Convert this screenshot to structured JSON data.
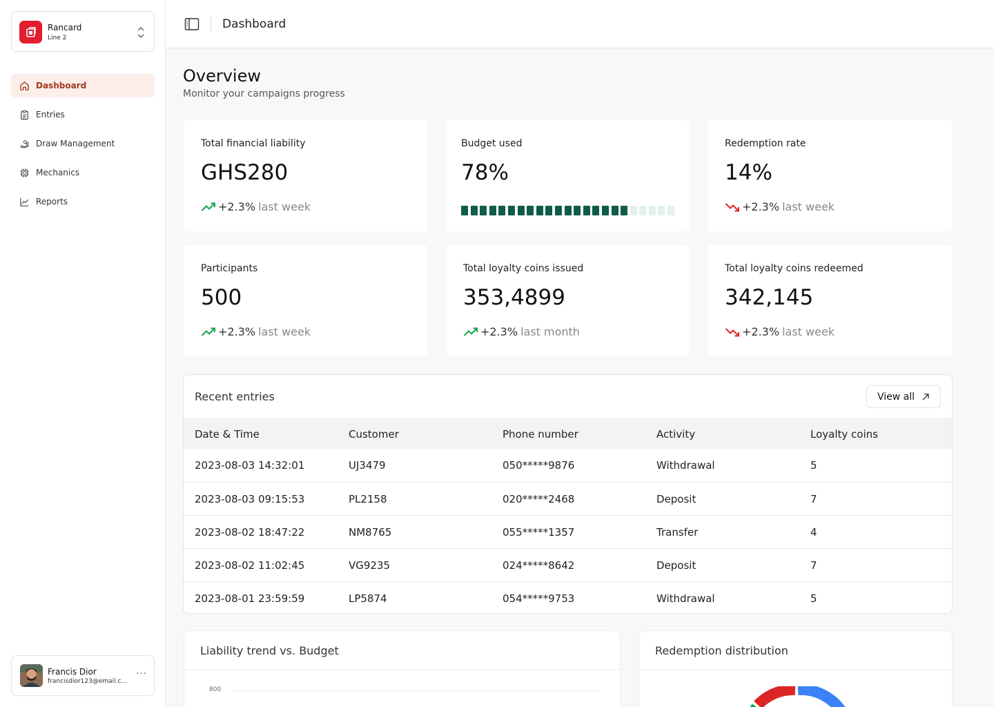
{
  "org": {
    "name": "Rancard",
    "line": "Line 2"
  },
  "nav": [
    {
      "label": "Dashboard",
      "icon": "home-icon",
      "active": true
    },
    {
      "label": "Entries",
      "icon": "clipboard-icon",
      "active": false
    },
    {
      "label": "Draw Management",
      "icon": "hand-coins-icon",
      "active": false
    },
    {
      "label": "Mechanics",
      "icon": "cpu-icon",
      "active": false
    },
    {
      "label": "Reports",
      "icon": "line-chart-icon",
      "active": false
    }
  ],
  "user": {
    "name": "Francis Dior",
    "email": "francisdior123@email.c..."
  },
  "header": {
    "title": "Dashboard"
  },
  "overview": {
    "title": "Overview",
    "subtitle": "Monitor your campaigns progress"
  },
  "cards": [
    {
      "label": "Total financial liability",
      "value": "GHS280",
      "trend": "+2.3%",
      "period": "last week",
      "direction": "up"
    },
    {
      "label": "Budget used",
      "value": "78%",
      "progress": 0.78
    },
    {
      "label": "Redemption rate",
      "value": "14%",
      "trend": "+2.3%",
      "period": "last week",
      "direction": "down"
    },
    {
      "label": "Participants",
      "value": "500",
      "trend": "+2.3%",
      "period": "last week",
      "direction": "up"
    },
    {
      "label": "Total loyalty coins issued",
      "value": "353,4899",
      "trend": "+2.3%",
      "period": "last month",
      "direction": "up"
    },
    {
      "label": "Total loyalty coins redeemed",
      "value": "342,145",
      "trend": "+2.3%",
      "period": "last week",
      "direction": "down"
    }
  ],
  "recent": {
    "title": "Recent entries",
    "view_all": "View all",
    "columns": [
      "Date & Time",
      "Customer",
      "Phone number",
      "Activity",
      "Loyalty coins"
    ],
    "rows": [
      [
        "2023-08-03 14:32:01",
        "UJ3479",
        "050*****9876",
        "Withdrawal",
        "5"
      ],
      [
        "2023-08-03 09:15:53",
        "PL2158",
        "020*****2468",
        "Deposit",
        "7"
      ],
      [
        "2023-08-02 18:47:22",
        "NM8765",
        "055*****1357",
        "Transfer",
        "4"
      ],
      [
        "2023-08-02 11:02:45",
        "VG9235",
        "024*****8642",
        "Deposit",
        "7"
      ],
      [
        "2023-08-01 23:59:59",
        "LP5874",
        "054*****9753",
        "Withdrawal",
        "5"
      ]
    ]
  },
  "liability_chart": {
    "title": "Liability trend vs. Budget",
    "y_tick": "800"
  },
  "redemption_chart": {
    "title": "Redemption distribution"
  },
  "colors": {
    "accent": "#e11d2e",
    "up": "#16a34a",
    "down": "#dc2626",
    "progress": "#0f5c4a",
    "progress_empty": "#e3f1ec"
  }
}
